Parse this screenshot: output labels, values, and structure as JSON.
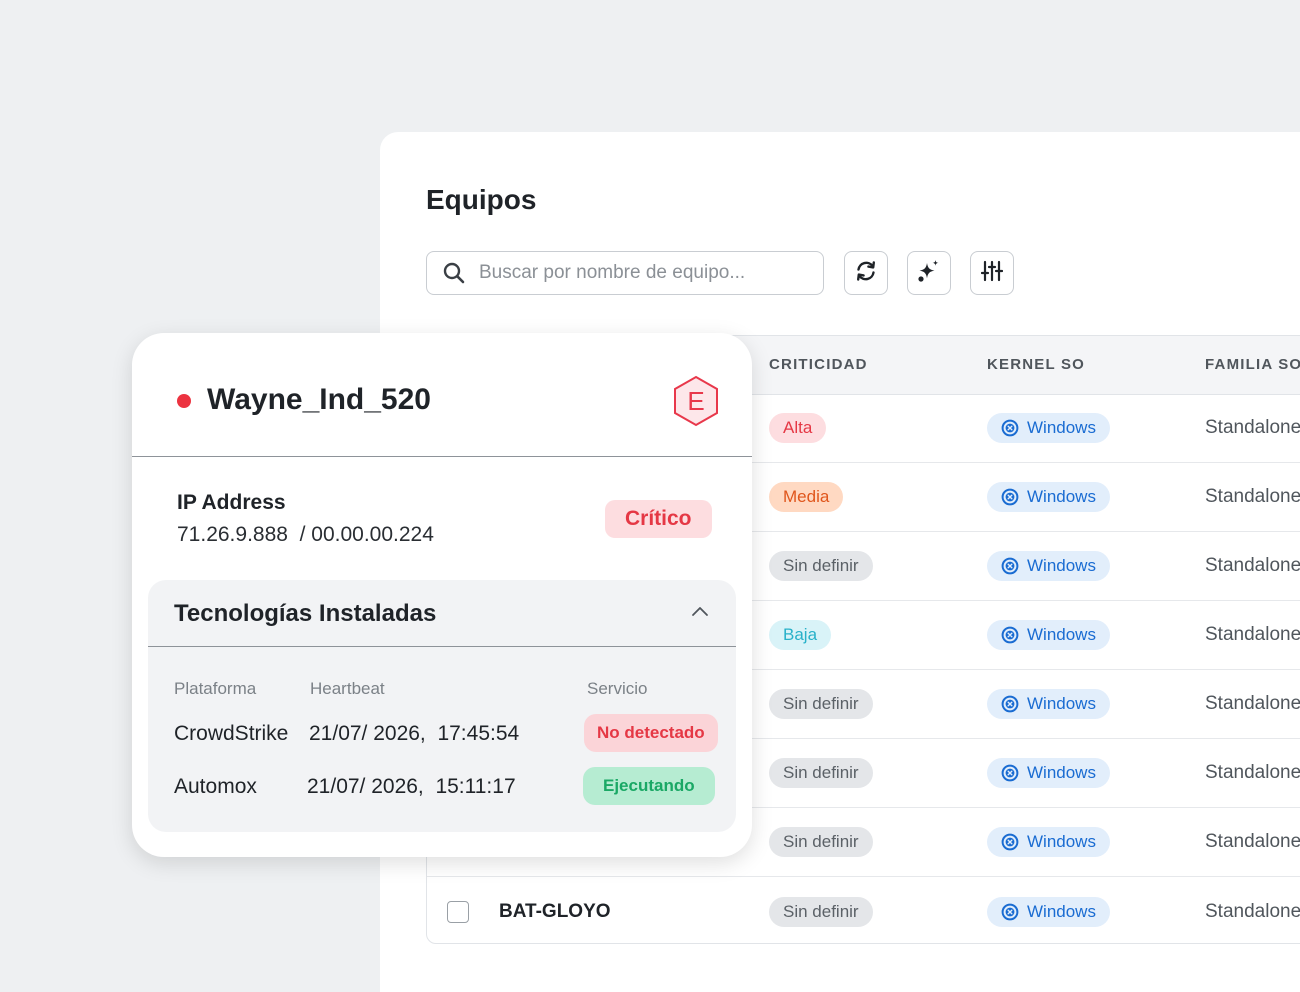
{
  "page": {
    "title": "Equipos"
  },
  "search": {
    "placeholder": "Buscar por nombre de equipo..."
  },
  "toolbar": {
    "refresh_icon": "refresh-icon",
    "sparkle_icon": "sparkle-icon",
    "filter_icon": "sliders-icon"
  },
  "table": {
    "headers": {
      "criticidad": "CRITICIDAD",
      "kernel": "KERNEL SO",
      "familia": "FAMILIA SO"
    },
    "rows": [
      {
        "equipo": "",
        "criticidad": "Alta",
        "crit_style": "alta",
        "kernel": "Windows",
        "familia": "Standalone"
      },
      {
        "equipo": "",
        "criticidad": "Media",
        "crit_style": "media",
        "kernel": "Windows",
        "familia": "Standalone"
      },
      {
        "equipo": "",
        "criticidad": "Sin definir",
        "crit_style": "none",
        "kernel": "Windows",
        "familia": "Standalone"
      },
      {
        "equipo": "",
        "criticidad": "Baja",
        "crit_style": "baja",
        "kernel": "Windows",
        "familia": "Standalone"
      },
      {
        "equipo": "",
        "criticidad": "Sin definir",
        "crit_style": "none",
        "kernel": "Windows",
        "familia": "Standalone"
      },
      {
        "equipo": "",
        "criticidad": "Sin definir",
        "crit_style": "none",
        "kernel": "Windows",
        "familia": "Standalone"
      },
      {
        "equipo": "",
        "criticidad": "Sin definir",
        "crit_style": "none",
        "kernel": "Windows",
        "familia": "Standalone"
      },
      {
        "equipo": "BAT-GLOYO",
        "criticidad": "Sin definir",
        "crit_style": "none",
        "kernel": "Windows",
        "familia": "Standalone"
      }
    ]
  },
  "card": {
    "device_name": "Wayne_Ind_520",
    "status_color": "#ec3340",
    "badge_letter": "E",
    "ip_label": "IP Address",
    "ip_value": "71.26.9.888  / 00.00.00.224",
    "criticality": "Crítico",
    "tech": {
      "title": "Tecnologías Instaladas",
      "headers": {
        "plataforma": "Plataforma",
        "heartbeat": "Heartbeat",
        "servicio": "Servicio"
      },
      "rows": [
        {
          "plataforma": "CrowdStrike",
          "heartbeat": "21/07/ 2026,  17:45:54",
          "servicio": "No detectado"
        },
        {
          "plataforma": "Automox",
          "heartbeat": "21/07/ 2026,  15:11:17",
          "servicio": "Ejecutando"
        }
      ]
    }
  },
  "colors": {
    "critical": "#e53845",
    "ok": "#1aa865",
    "windows": "#1a6cd2"
  }
}
